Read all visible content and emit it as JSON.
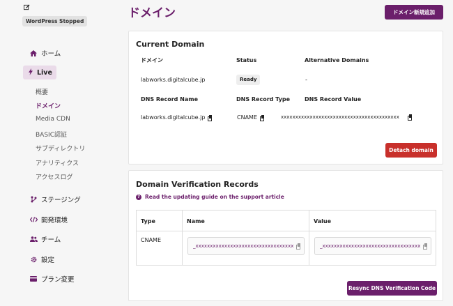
{
  "sidebar": {
    "status_badge": "WordPress Stopped",
    "nav": {
      "home": "ホーム",
      "live": "Live",
      "staging": "ステージング",
      "dev_env": "開発環境",
      "team": "チーム",
      "settings": "設定",
      "plan_change": "プラン変更"
    },
    "live_sub": [
      "概要",
      "ドメイン",
      "Media CDN",
      "BASIC認証",
      "サブディレクトリ",
      "アナリティクス",
      "アクセスログ"
    ],
    "active_sub": "ドメイン"
  },
  "header": {
    "title": "ドメイン",
    "add_domain_button": "ドメイン新規追加"
  },
  "current_domain": {
    "title": "Current Domain",
    "headers": {
      "domain": "ドメイン",
      "status": "Status",
      "alt_domains": "Alternative Domains",
      "dns_name": "DNS Record Name",
      "dns_type": "DNS Record Type",
      "dns_value": "DNS Record Value"
    },
    "domain": "labworks.digitalcube.jp",
    "status": "Ready",
    "alt_domains": "-",
    "dns_name": "labworks.digitalcube.jp",
    "dns_type": "CNAME",
    "dns_value": "xxxxxxxxxxxxxxxxxxxxxxxxxxxxxxxxxxxxxxxxx",
    "detach_button": "Detach domain"
  },
  "verification": {
    "title": "Domain Verification Records",
    "help_link": "Read the updating guide on the support article",
    "columns": [
      "Type",
      "Name",
      "Value"
    ],
    "row": {
      "type": "CNAME",
      "name": "_xxxxxxxxxxxxxxxxxxxxxxxxxxxxxxxxxx",
      "value": "_xxxxxxxxxxxxxxxxxxxxxxxxxxxxxxxxxx"
    },
    "resync_button": "Resync DNS Verification Code"
  },
  "colors": {
    "brand": "#6b1f6b",
    "danger": "#c8302b",
    "live_bg": "#eadbe9"
  }
}
